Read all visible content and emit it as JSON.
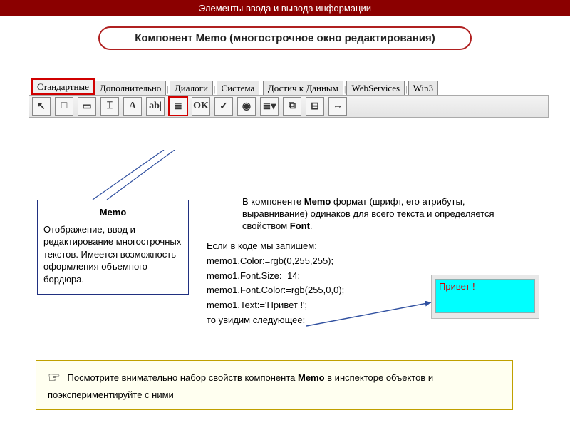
{
  "header": "Элементы ввода и вывода информации",
  "title_prefix": "Компонент ",
  "title_bold": "Memo",
  "title_suffix": " (многострочное окно редактирования)",
  "tabs": {
    "t0": "Стандартные",
    "t1": "Дополнительно",
    "t2": "Диалоги",
    "t3": "Система",
    "t4": "Достич к Данным",
    "t5": "WebServices",
    "t6": "Win3"
  },
  "toolbar_icons": {
    "i0": "↖",
    "i1": "□",
    "i2": "▭",
    "i3": "⌶",
    "i4": "A",
    "i5": "ab|",
    "i6": "≣",
    "i7": "OK",
    "i8": "✓",
    "i9": "◉",
    "i10": "≣▾",
    "i11": "⧉",
    "i12": "⊟",
    "i13": "↔"
  },
  "memo_title": "Memo",
  "memo_desc": " Отображение, ввод и редактирование многострочных текстов. Имеется возможность оформления объемного бордюра.",
  "right_para_a": "   В компоненте ",
  "right_para_b": "Memo",
  "right_para_c": " формат (шрифт, его атрибуты, выравнивание) одинаков для всего текста и определяется свойством ",
  "right_para_d": "Font",
  "right_para_e": ".",
  "code": {
    "l0": "Если в коде мы запишем:",
    "l1": "memo1.Color:=rgb(0,255,255);",
    "l2": "memo1.Font.Size:=14;",
    "l3": "memo1.Font.Color:=rgb(255,0,0);",
    "l4": "memo1.Text:='Привет !';",
    "l5": "то увидим следующее:"
  },
  "output_text": "Привет !",
  "note_icon": "☞",
  "note_a": " Посмотрите внимательно набор свойств компонента ",
  "note_b": "Memo",
  "note_c": " в инспекторе объектов и поэкспериментируйте с ними"
}
